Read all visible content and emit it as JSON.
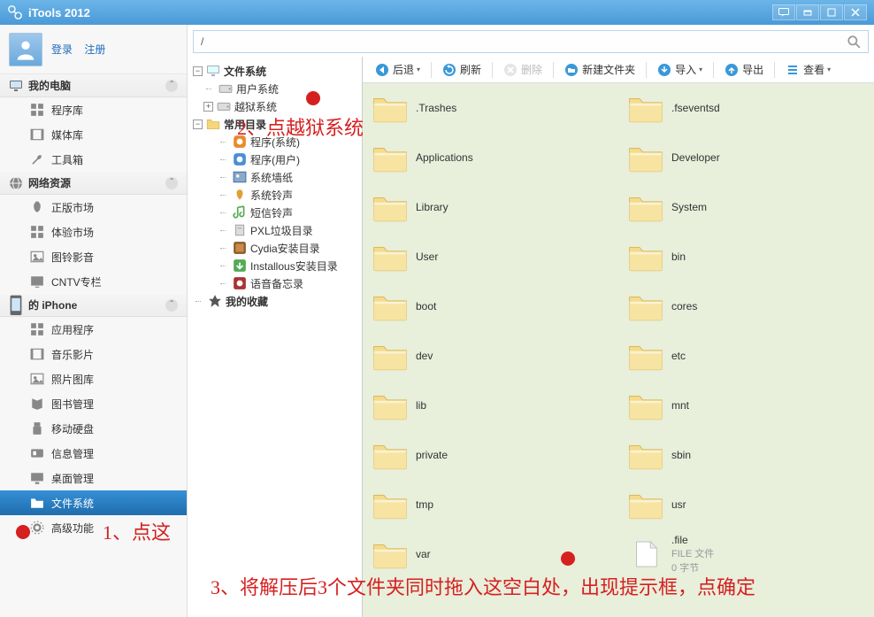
{
  "app": {
    "title": "iTools 2012"
  },
  "account": {
    "login": "登录",
    "register": "注册"
  },
  "sidebar": {
    "sec_mypc": "我的电脑",
    "items_mypc": [
      "程序库",
      "媒体库",
      "工具箱"
    ],
    "sec_net": "网络资源",
    "items_net": [
      "正版市场",
      "体验市场",
      "图铃影音",
      "CNTV专栏"
    ],
    "sec_device": "的 iPhone",
    "items_device": [
      "应用程序",
      "音乐影片",
      "照片图库",
      "图书管理",
      "移动硬盘",
      "信息管理",
      "桌面管理",
      "文件系统",
      "高级功能"
    ]
  },
  "path": {
    "value": "/"
  },
  "tree": {
    "root": "文件系统",
    "user_sys": "用户系统",
    "jail_sys": "越狱系统",
    "common": "常用目录",
    "common_items": [
      "程序(系统)",
      "程序(用户)",
      "系统墙纸",
      "系统铃声",
      "短信铃声",
      "PXL垃圾目录",
      "Cydia安装目录",
      "Installous安装目录",
      "语音备忘录"
    ],
    "fav": "我的收藏"
  },
  "toolbar": {
    "back": "后退",
    "refresh": "刷新",
    "delete": "删除",
    "newfolder": "新建文件夹",
    "import": "导入",
    "export": "导出",
    "view": "查看"
  },
  "folders_left": [
    ".Trashes",
    "Applications",
    "Library",
    "User",
    "boot",
    "dev",
    "lib",
    "private",
    "tmp",
    "var"
  ],
  "folders_right": [
    ".fseventsd",
    "Developer",
    "System",
    "bin",
    "cores",
    "etc",
    "mnt",
    "sbin",
    "usr"
  ],
  "file_item": {
    "name": ".file",
    "line2": "FILE 文件",
    "line3": "0 字节"
  },
  "annotations": {
    "a1": "1、点这",
    "a2": "2、点越狱系统",
    "a3": "3、将解压后3个文件夹同时拖入这空白处，出现提示框，点确定"
  }
}
